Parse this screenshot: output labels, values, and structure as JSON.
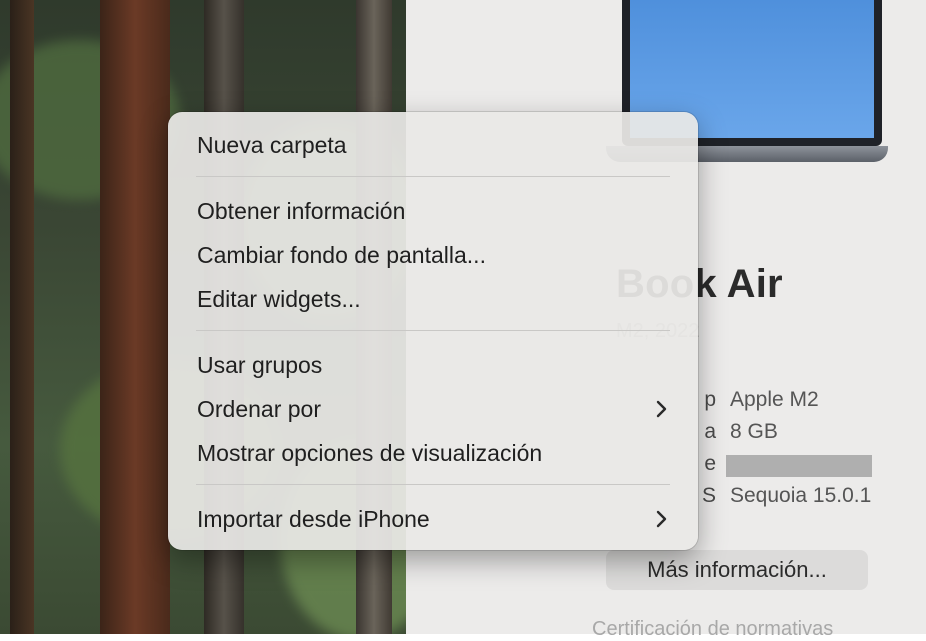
{
  "about_window": {
    "model_title": "Book Air",
    "model_subtitle": "M2, 2022",
    "specs": [
      {
        "key": "p",
        "value": "Apple M2"
      },
      {
        "key": "a",
        "value": "8 GB"
      },
      {
        "key": "e",
        "value": ""
      },
      {
        "key": "S",
        "value": "Sequoia 15.0.1"
      }
    ],
    "more_info_button": "Más información...",
    "regulatory_link": "Certificación de normativas"
  },
  "context_menu": {
    "items": [
      {
        "label": "Nueva carpeta"
      },
      {
        "label": "Obtener información"
      },
      {
        "label": "Cambiar fondo de pantalla..."
      },
      {
        "label": "Editar widgets..."
      },
      {
        "label": "Usar grupos"
      },
      {
        "label": "Ordenar por",
        "submenu": true
      },
      {
        "label": "Mostrar opciones de visualización"
      },
      {
        "label": "Importar desde iPhone",
        "submenu": true
      }
    ]
  },
  "icons": {
    "submenu_chevron": "chevron-right-icon"
  },
  "colors": {
    "menu_background": "#e9e8e6",
    "window_background": "#ecebea",
    "laptop_screen": "#5a9ae2"
  }
}
